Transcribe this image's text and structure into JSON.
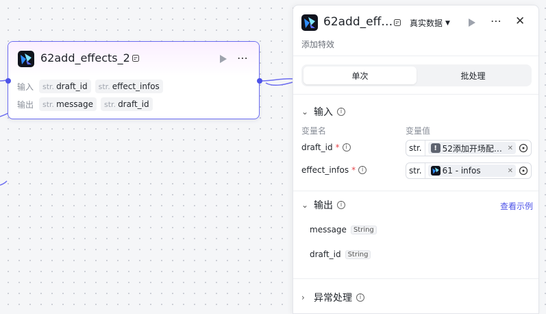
{
  "node": {
    "title": "62add_effects_2",
    "inputs_label": "输入",
    "outputs_label": "输出",
    "inputs": [
      {
        "type": "str.",
        "name": "draft_id"
      },
      {
        "type": "str.",
        "name": "effect_infos"
      }
    ],
    "outputs": [
      {
        "type": "str.",
        "name": "message"
      },
      {
        "type": "str.",
        "name": "draft_id"
      }
    ]
  },
  "panel": {
    "title": "62add_eff…",
    "dataset_label": "真实数据",
    "description": "添加特效",
    "tabs": [
      "单次",
      "批处理"
    ],
    "active_tab": "单次",
    "input_section": {
      "title": "输入",
      "col_name": "变量名",
      "col_value": "变量值",
      "vars": [
        {
          "name": "draft_id",
          "type": "str.",
          "ref": "52添加开场配…",
          "ref_icon": "warning-icon"
        },
        {
          "name": "effect_infos",
          "type": "str.",
          "ref": "61 - infos",
          "ref_icon": "plugin-logo-icon"
        }
      ]
    },
    "output_section": {
      "title": "输出",
      "link": "查看示例",
      "vars": [
        {
          "name": "message",
          "type": "String"
        },
        {
          "name": "draft_id",
          "type": "String"
        }
      ]
    },
    "error_section": {
      "title": "异常处理"
    }
  },
  "colors": {
    "accent": "#4d53e8",
    "node_border": "#6b6cf0",
    "required": "#e5484d"
  }
}
